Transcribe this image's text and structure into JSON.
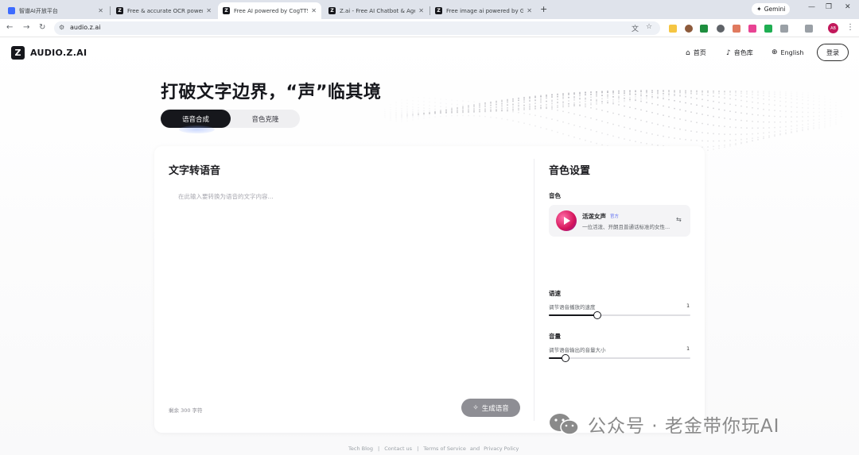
{
  "browser": {
    "tabs": [
      {
        "title": "智谱AI开放平台",
        "active": false,
        "favicon_color": "#3d6bff"
      },
      {
        "title": "Free & accurate OCR powered by",
        "active": false,
        "favicon_color": "#16171c"
      },
      {
        "title": "Free AI powered by CogTTS",
        "active": true,
        "favicon_color": "#16171c"
      },
      {
        "title": "Z.ai - Free AI Chatbot & Agent",
        "active": false,
        "favicon_color": "#16171c"
      },
      {
        "title": "Free image ai powered by GL",
        "active": false,
        "favicon_color": "#16171c"
      }
    ],
    "gemini_label": "Gemini",
    "url": "audio.z.ai",
    "profile_initials": "AB"
  },
  "site": {
    "logo_letter": "Z",
    "logo_text": "AUDIO.Z.AI",
    "nav": {
      "home": "首页",
      "voice_library": "音色库",
      "language": "English",
      "login": "登录"
    },
    "hero_title": "打破文字边界，“声”临其境",
    "modes": {
      "active": "语音合成",
      "inactive": "音色克隆"
    },
    "editor": {
      "title": "文字转语音",
      "placeholder": "在此输入要转换为语音的文字内容...",
      "char_count": "剩余 300 字符",
      "generate_label": "生成语音"
    },
    "settings": {
      "title": "音色设置",
      "voice_label": "音色",
      "voice_name": "活泼女声",
      "voice_tag": "官方",
      "voice_desc": "一位活泼、开朗且普通话标准的女性...",
      "speed_label": "语速",
      "speed_hint": "调节语音播放的速度",
      "speed_value": "1",
      "speed_level": 0.34,
      "volume_label": "音量",
      "volume_hint": "调节语音输出的音量大小",
      "volume_value": "1",
      "volume_level": 0.12
    },
    "footer": {
      "tech_blog": "Tech Blog",
      "contact": "Contact us",
      "terms": "Terms of Service",
      "and": "and",
      "privacy": "Privacy Policy"
    }
  },
  "watermark": "公众号 · 老金带你玩AI"
}
